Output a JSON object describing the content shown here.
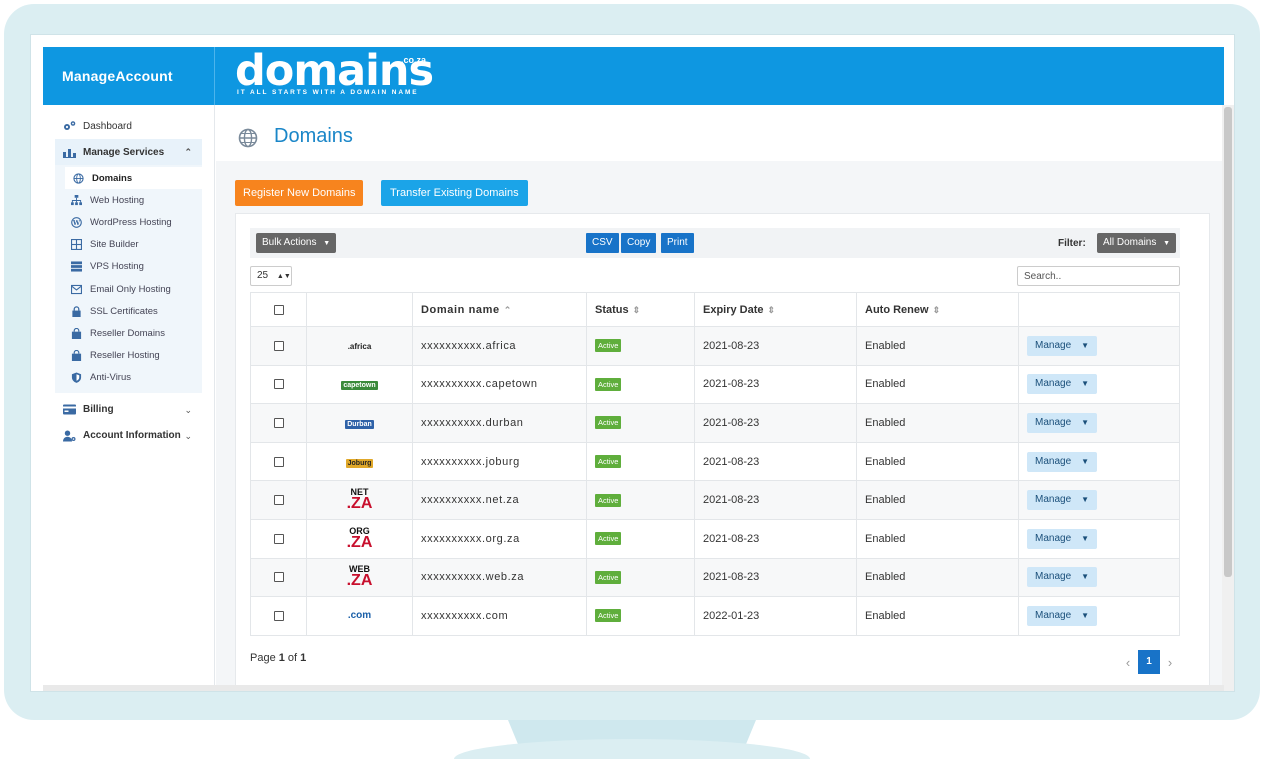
{
  "header": {
    "app_name": "ManageAccount",
    "logo_word": "domains",
    "logo_tld": ".co.za",
    "logo_tagline": "IT ALL STARTS WITH A DOMAIN NAME"
  },
  "sidebar": {
    "dashboard": "Dashboard",
    "manage_services": "Manage Services",
    "sub_items": [
      "Domains",
      "Web Hosting",
      "WordPress Hosting",
      "Site Builder",
      "VPS Hosting",
      "Email Only Hosting",
      "SSL Certificates",
      "Reseller Domains",
      "Reseller Hosting",
      "Anti-Virus"
    ],
    "billing": "Billing",
    "account_information": "Account Information"
  },
  "page": {
    "title": "Domains",
    "register_button": "Register New Domains",
    "transfer_button": "Transfer Existing Domains"
  },
  "toolbar": {
    "bulk_actions": "Bulk Actions",
    "csv": "CSV",
    "copy": "Copy",
    "print": "Print",
    "filter_label": "Filter:",
    "filter_value": "All Domains",
    "page_size": "25",
    "search_placeholder": "Search.."
  },
  "table": {
    "headers": {
      "domain": "Domain name",
      "status": "Status",
      "expiry": "Expiry Date",
      "auto_renew": "Auto Renew"
    },
    "manage_label": "Manage",
    "rows": [
      {
        "logo": ".africa",
        "domain": "xxxxxxxxxx.africa",
        "status": "Active",
        "expiry": "2021-08-23",
        "auto_renew": "Enabled"
      },
      {
        "logo": "capetown",
        "domain": "xxxxxxxxxx.capetown",
        "status": "Active",
        "expiry": "2021-08-23",
        "auto_renew": "Enabled"
      },
      {
        "logo": "Durban",
        "domain": "xxxxxxxxxx.durban",
        "status": "Active",
        "expiry": "2021-08-23",
        "auto_renew": "Enabled"
      },
      {
        "logo": "Joburg",
        "domain": "xxxxxxxxxx.joburg",
        "status": "Active",
        "expiry": "2021-08-23",
        "auto_renew": "Enabled"
      },
      {
        "logo_top": "NET",
        "logo_bottom": ".ZA",
        "domain": "xxxxxxxxxx.net.za",
        "status": "Active",
        "expiry": "2021-08-23",
        "auto_renew": "Enabled"
      },
      {
        "logo_top": "ORG",
        "logo_bottom": ".ZA",
        "domain": "xxxxxxxxxx.org.za",
        "status": "Active",
        "expiry": "2021-08-23",
        "auto_renew": "Enabled"
      },
      {
        "logo_top": "WEB",
        "logo_bottom": ".ZA",
        "domain": "xxxxxxxxxx.web.za",
        "status": "Active",
        "expiry": "2021-08-23",
        "auto_renew": "Enabled"
      },
      {
        "logo": ".com",
        "domain": "xxxxxxxxxx.com",
        "status": "Active",
        "expiry": "2022-01-23",
        "auto_renew": "Enabled"
      }
    ]
  },
  "footer": {
    "page_prefix": "Page ",
    "page_current": "1",
    "page_mid": " of ",
    "page_total": "1",
    "pager_current": "1"
  },
  "colors": {
    "header_blue": "#0e97e1",
    "orange": "#f7841e",
    "active_green": "#5fae3c",
    "button_blue": "#1873c8"
  }
}
